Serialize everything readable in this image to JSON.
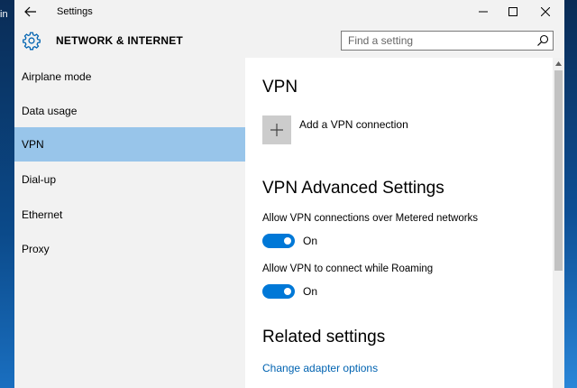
{
  "desktop": {
    "left_text": "in"
  },
  "window": {
    "title": "Settings",
    "back_icon": "arrow-left-icon",
    "controls": [
      "minimize-icon",
      "maximize-icon",
      "close-icon"
    ]
  },
  "header": {
    "icon": "gear-icon",
    "title": "NETWORK & INTERNET",
    "search": {
      "placeholder": "Find a setting",
      "value": ""
    }
  },
  "sidebar": {
    "items": [
      {
        "label": "Airplane mode",
        "selected": false
      },
      {
        "label": "Data usage",
        "selected": false
      },
      {
        "label": "VPN",
        "selected": true
      },
      {
        "label": "Dial-up",
        "selected": false
      },
      {
        "label": "Ethernet",
        "selected": false
      },
      {
        "label": "Proxy",
        "selected": false
      }
    ]
  },
  "main": {
    "vpn_heading": "VPN",
    "add_vpn_label": "Add a VPN connection",
    "advanced_heading": "VPN Advanced Settings",
    "settings": [
      {
        "label": "Allow VPN connections over Metered networks",
        "state": "On",
        "on": true
      },
      {
        "label": "Allow VPN to connect while Roaming",
        "state": "On",
        "on": true
      }
    ],
    "related_heading": "Related settings",
    "related_link": "Change adapter options"
  },
  "colors": {
    "accent": "#0078d7",
    "selected_nav": "#98c5ea",
    "link": "#0063b1",
    "chrome": "#f2f2f2"
  }
}
